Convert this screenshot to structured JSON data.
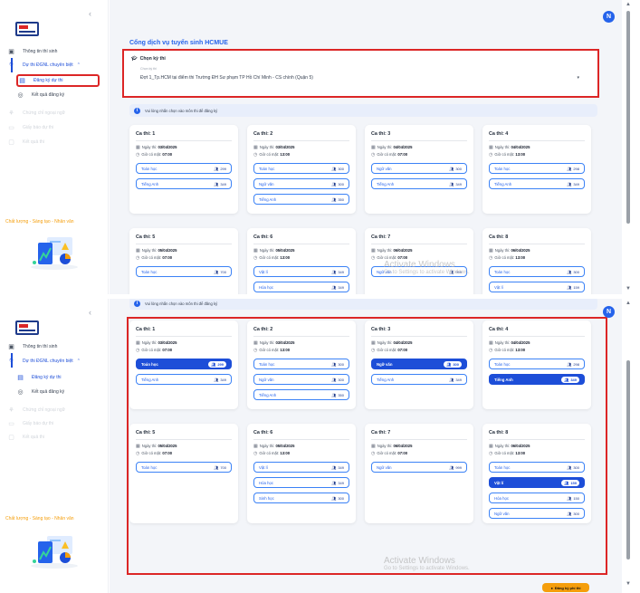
{
  "sidebar": {
    "collapse_icon": "chevron-left-icon",
    "items": [
      {
        "label": "Thông tin thí sinh",
        "icon": "id-card-icon"
      },
      {
        "label": "Dự thi ĐGNL chuyên biệt",
        "icon": "exam-icon"
      },
      {
        "label": "Đăng ký dự thi",
        "icon": "form-icon"
      },
      {
        "label": "Kết quả đăng ký",
        "icon": "check-circle-icon"
      },
      {
        "label": "Chứng chỉ ngoại ngữ",
        "icon": "cert-icon"
      },
      {
        "label": "Giấy báo dự thi",
        "icon": "doc-icon"
      },
      {
        "label": "Kết quả thi",
        "icon": "grade-icon"
      }
    ],
    "slogan": "Chất lượng - Sáng tạo - Nhân văn"
  },
  "header": {
    "avatar_initial": "N"
  },
  "main": {
    "title": "Cổng dịch vụ tuyển sinh HCMUE",
    "select": {
      "heading": "Chọn kỳ thi",
      "label": "Chọn kỳ thi",
      "value": "Đợt 1_Tp.HCM tại điểm thi Trường ĐH Sư phạm TP Hồ Chí Minh - CS chính (Quận 5)"
    },
    "notice": "Vui lòng nhấn chọn vào môn thi để đăng ký",
    "date_label": "Ngày thi:",
    "time_label": "Giờ có mặt:",
    "sessions": [
      {
        "title": "Ca thi: 1",
        "date": "03/04/2025",
        "time": "07:00",
        "subjects": [
          {
            "name": "Toán học",
            "count": "299"
          },
          {
            "name": "Tiếng Anh",
            "count": "349"
          }
        ]
      },
      {
        "title": "Ca thi: 2",
        "date": "03/04/2025",
        "time": "13:00",
        "subjects": [
          {
            "name": "Toán học",
            "count": "300"
          },
          {
            "name": "Ngữ văn",
            "count": "300"
          },
          {
            "name": "Tiếng Anh",
            "count": "350"
          }
        ]
      },
      {
        "title": "Ca thi: 3",
        "date": "04/04/2025",
        "time": "07:00",
        "subjects": [
          {
            "name": "Ngữ văn",
            "count": "300"
          },
          {
            "name": "Tiếng Anh",
            "count": "349"
          }
        ]
      },
      {
        "title": "Ca thi: 4",
        "date": "04/04/2025",
        "time": "13:00",
        "subjects": [
          {
            "name": "Toán học",
            "count": "298"
          },
          {
            "name": "Tiếng Anh",
            "count": "349"
          }
        ]
      },
      {
        "title": "Ca thi: 5",
        "date": "05/04/2025",
        "time": "07:00",
        "subjects": [
          {
            "name": "Toán học",
            "count": "700"
          }
        ]
      },
      {
        "title": "Ca thi: 6",
        "date": "05/04/2025",
        "time": "13:00",
        "subjects": [
          {
            "name": "Vật lí",
            "count": "349"
          },
          {
            "name": "Hóa học",
            "count": "349"
          },
          {
            "name": "Sinh học",
            "count": "300"
          }
        ]
      },
      {
        "title": "Ca thi: 7",
        "date": "06/04/2025",
        "time": "07:00",
        "subjects": [
          {
            "name": "Ngữ văn",
            "count": "999"
          }
        ]
      },
      {
        "title": "Ca thi: 8",
        "date": "06/04/2025",
        "time": "13:00",
        "subjects": [
          {
            "name": "Toán học",
            "count": "300"
          },
          {
            "name": "Vật lí",
            "count": "159"
          },
          {
            "name": "Hóa học",
            "count": "150"
          },
          {
            "name": "Ngữ văn",
            "count": "300"
          }
        ]
      }
    ],
    "selected_subjects": [
      "1-0",
      "3-0",
      "4-1",
      "8-1"
    ],
    "register_button": "Đăng ký phí thi"
  },
  "watermark": {
    "line1": "Activate Windows",
    "line2": "Go to Settings to activate Windows."
  }
}
